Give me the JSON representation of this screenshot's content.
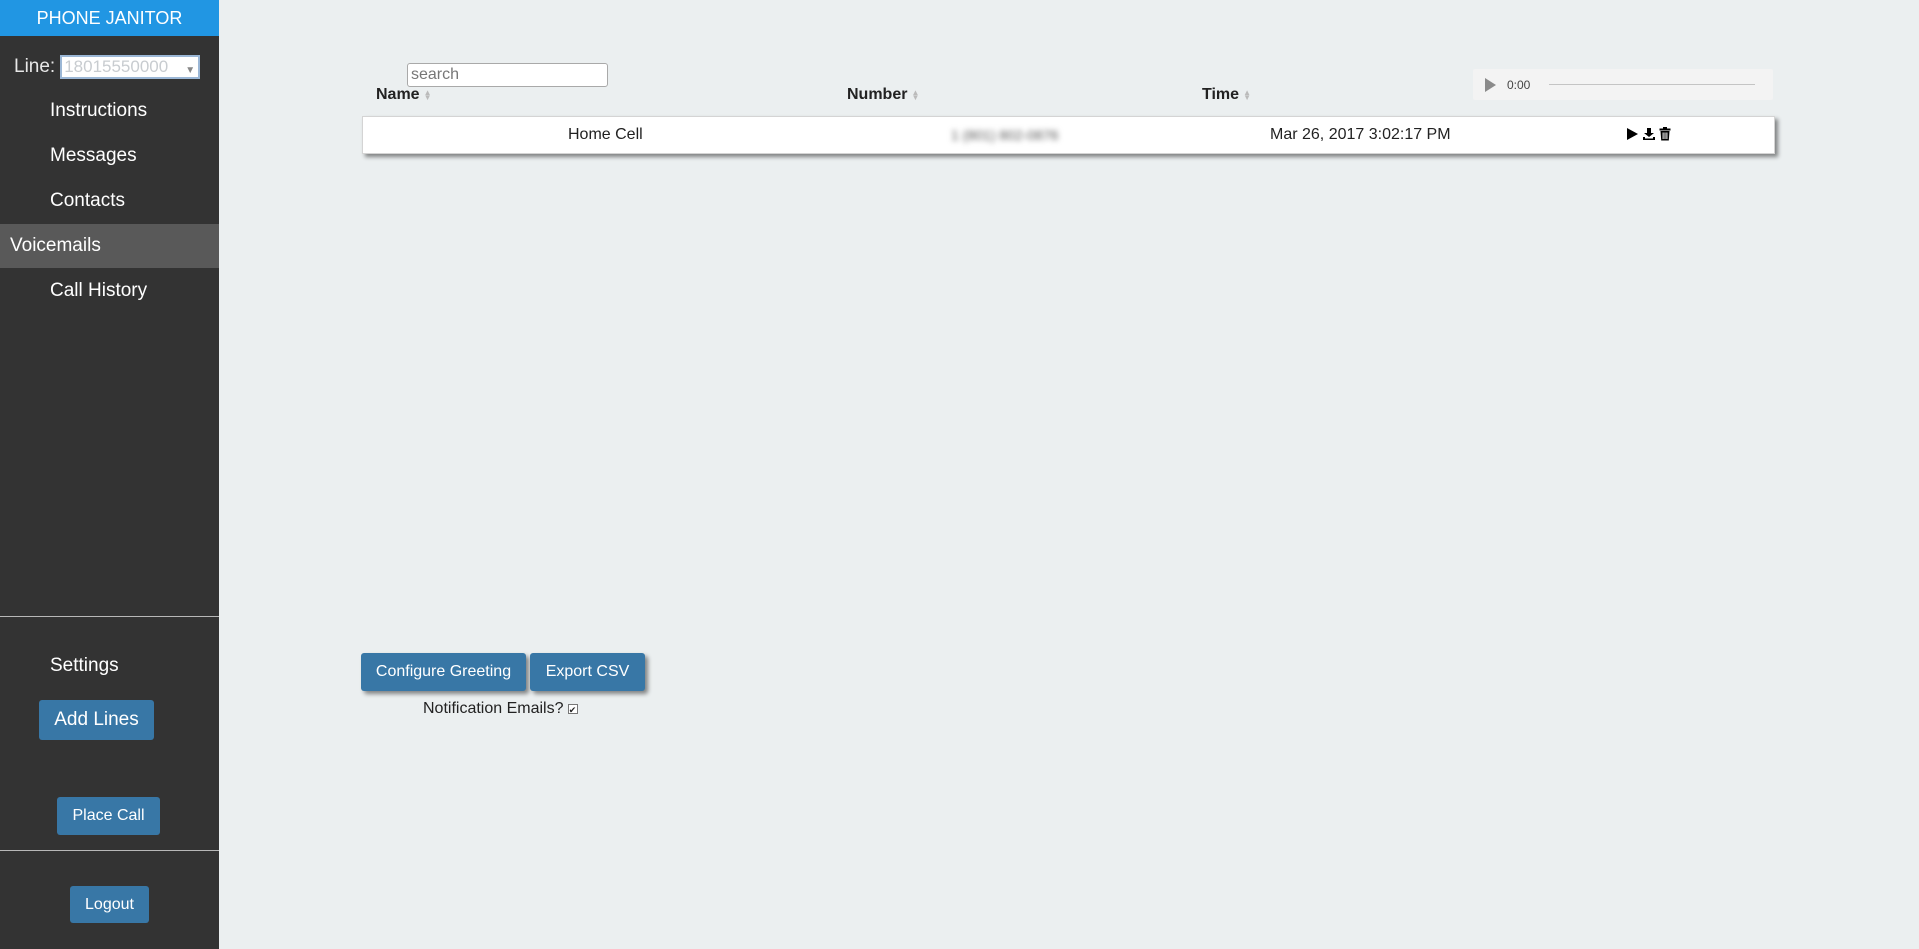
{
  "app": {
    "title": "PHONE JANITOR"
  },
  "line": {
    "label": "Line:",
    "selected": "18015550000"
  },
  "nav": {
    "items": [
      {
        "label": "Instructions"
      },
      {
        "label": "Messages"
      },
      {
        "label": "Contacts"
      },
      {
        "label": "Voicemails"
      },
      {
        "label": "Call History"
      }
    ],
    "active": "Voicemails"
  },
  "sidebar_bottom": {
    "settings_label": "Settings",
    "add_lines_label": "Add Lines",
    "place_call_label": "Place Call",
    "logout_label": "Logout"
  },
  "search": {
    "placeholder": "search",
    "value": ""
  },
  "table": {
    "columns": [
      "Name",
      "Number",
      "Time"
    ],
    "rows": [
      {
        "name": "Home Cell",
        "number": "1 (801) 802-0876",
        "time": "Mar 26, 2017 3:02:17 PM"
      }
    ]
  },
  "player": {
    "time": "0:00"
  },
  "actions": {
    "configure_greeting_label": "Configure Greeting",
    "export_csv_label": "Export CSV",
    "notification_label": "Notification Emails?",
    "notification_checked": true
  },
  "colors": {
    "brand": "#2196e3",
    "button": "#3877a6",
    "sidebar": "#333333",
    "background": "#ebeff0"
  }
}
